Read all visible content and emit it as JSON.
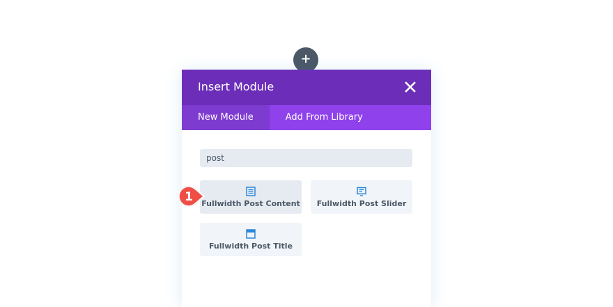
{
  "add_button": {
    "symbol": "+"
  },
  "modal": {
    "title": "Insert Module",
    "close_icon": "close-icon",
    "tabs": [
      {
        "label": "New Module",
        "active": true
      },
      {
        "label": "Add From Library",
        "active": false
      }
    ],
    "search": {
      "value": "post"
    },
    "modules": [
      {
        "label": "Fullwidth Post Content",
        "icon": "post-content-icon"
      },
      {
        "label": "Fullwidth Post Slider",
        "icon": "post-slider-icon"
      },
      {
        "label": "Fullwidth Post Title",
        "icon": "post-title-icon"
      }
    ]
  },
  "annotation": {
    "step_number": "1"
  },
  "colors": {
    "header": "#6c2eb9",
    "tab_bar": "#8f42ec",
    "active_tab": "#7e3bd0",
    "icon": "#2b87da",
    "badge": "#ef4e46",
    "add_button": "#4c5866"
  }
}
